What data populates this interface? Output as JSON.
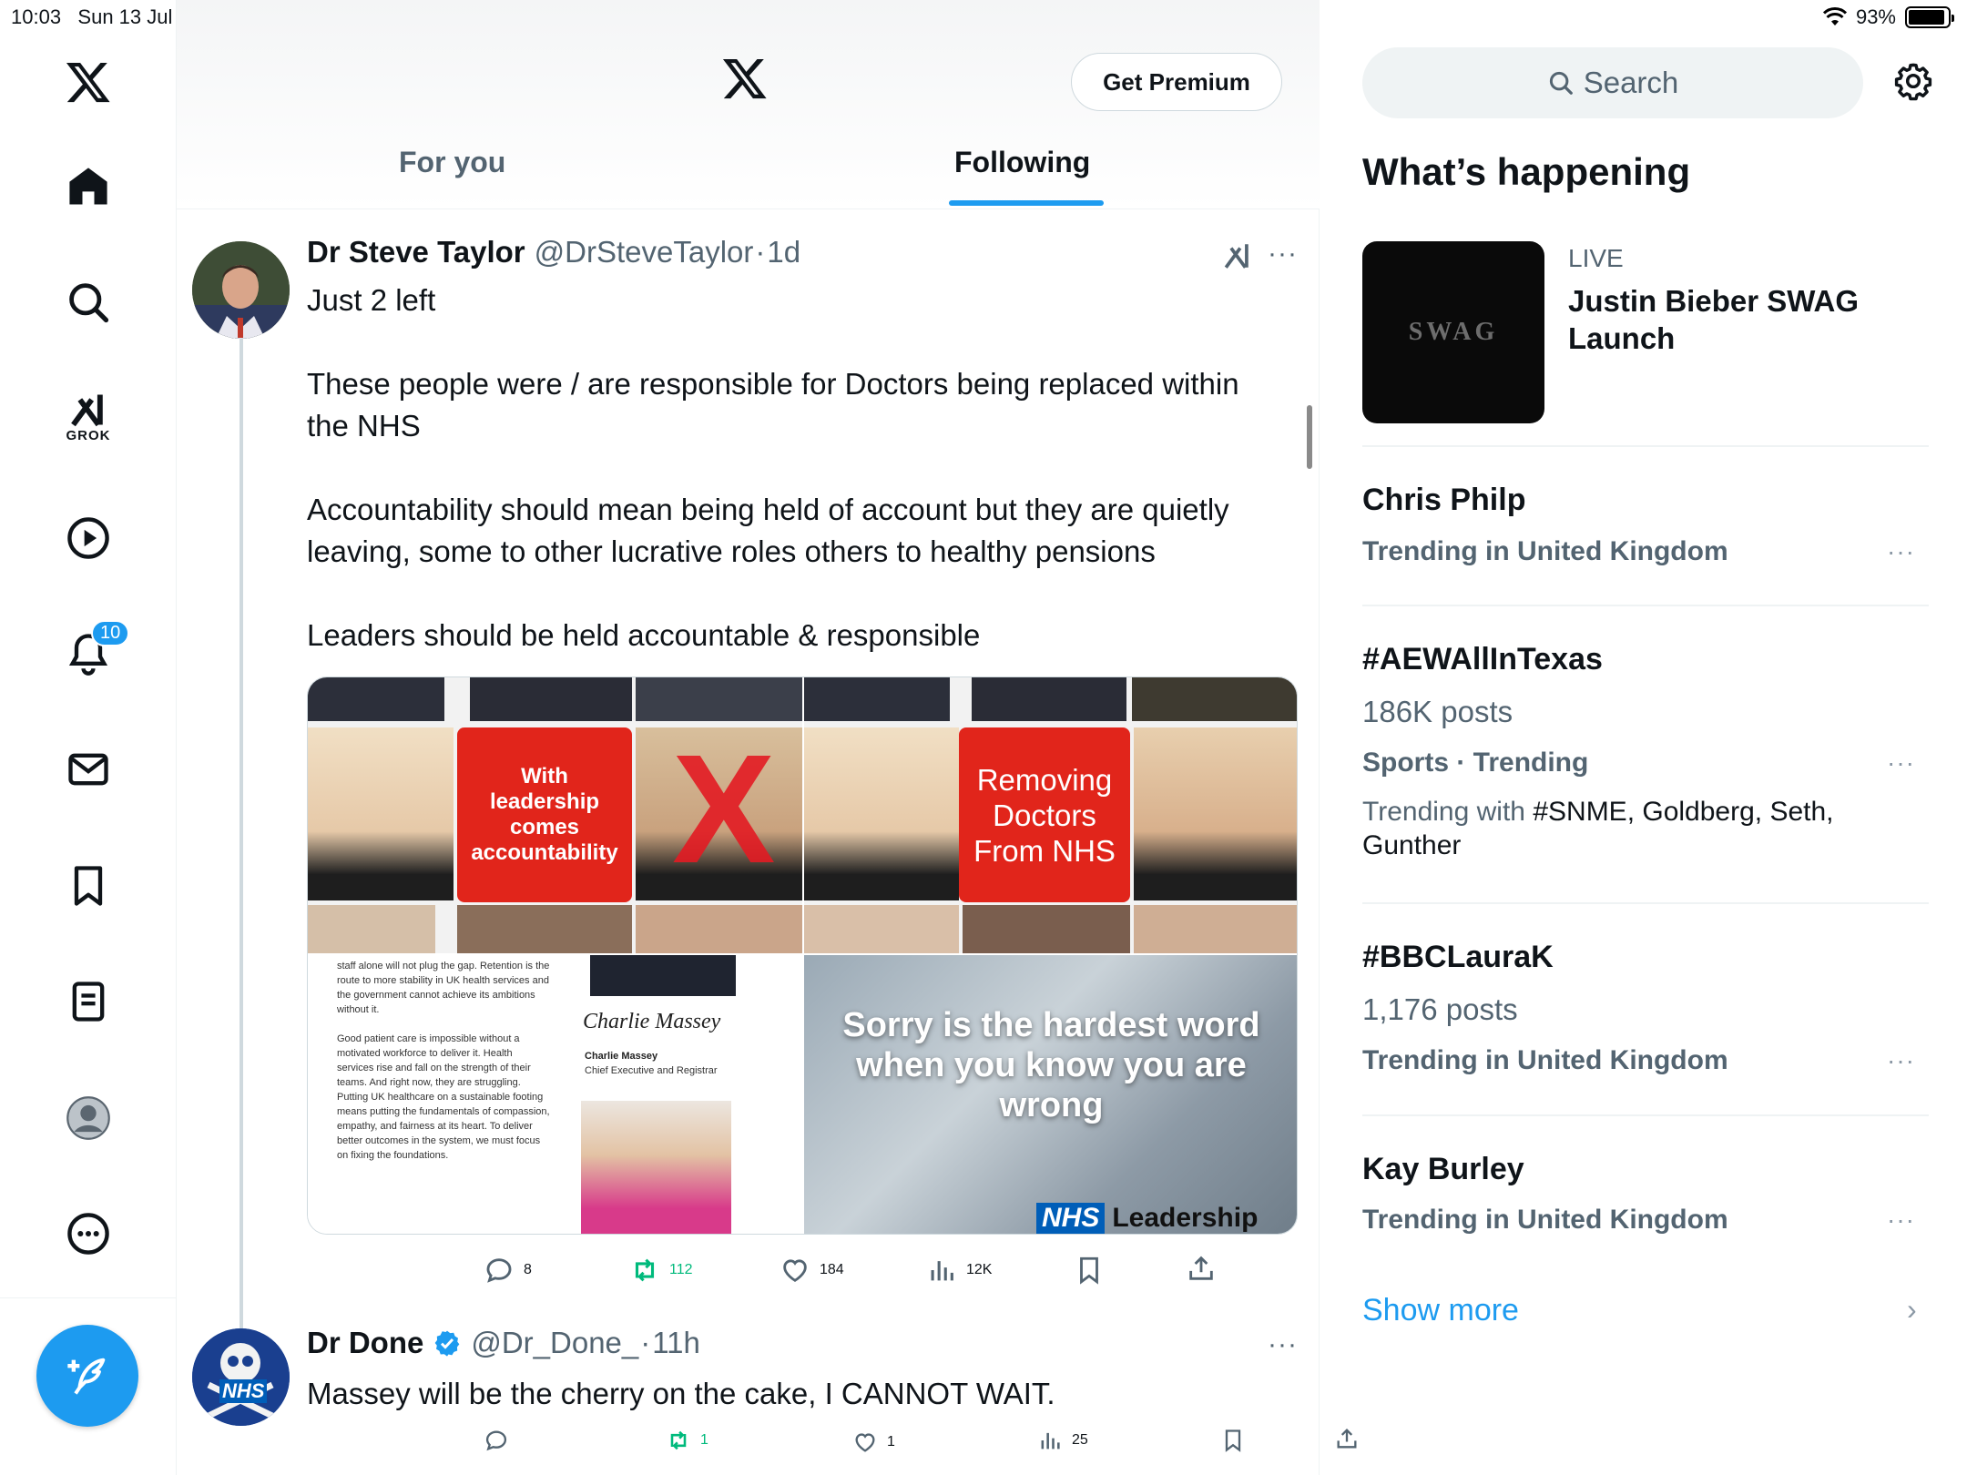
{
  "status_bar": {
    "time": "10:03",
    "date": "Sun 13 Jul",
    "dots": "•••",
    "battery": "93%",
    "battery_level": 0.93
  },
  "nav": {
    "grok_label": "GROK",
    "notifications_badge": "10",
    "icons": [
      "x-logo-icon",
      "home-icon",
      "search-icon",
      "grok-icon",
      "video-icon",
      "bell-icon",
      "mail-icon",
      "bookmark-icon",
      "list-icon",
      "profile-icon",
      "more-circle-icon",
      "compose-icon"
    ]
  },
  "header": {
    "premium_label": "Get Premium",
    "tabs": [
      {
        "label": "For you"
      },
      {
        "label": "Following"
      }
    ],
    "active_tab": "Following"
  },
  "tweets": [
    {
      "name": "Dr Steve Taylor",
      "handle": "@DrSteveTaylor",
      "dot": "·",
      "time": "1d",
      "more": "···",
      "paragraphs": [
        "Just 2 left",
        "These people were / are responsible for Doctors being replaced within the NHS",
        "Accountability should mean being held of account but they are quietly leaving, some to other lucrative roles others to healthy pensions",
        "Leaders should be held accountable & responsible"
      ],
      "media": {
        "panel1_text": "With leadership comes accountability",
        "panel2_text": "Removing Doctors From NHS",
        "panel3_doc_lines": [
          "staff alone will not plug the gap. Retention is the",
          "route to more stability in UK health services and",
          "the government cannot achieve its ambitions",
          "without it.",
          "",
          "Good patient care is impossible without a",
          "motivated workforce to deliver it. Health",
          "services rise and fall on the strength of their",
          "teams. And right now, they are struggling.",
          "Putting UK healthcare on a sustainable footing",
          "means putting the fundamentals of compassion,",
          "empathy, and fairness at its heart. To deliver",
          "better outcomes in the system, we must focus",
          "on fixing the foundations."
        ],
        "panel3_signature": "Charlie Massey",
        "panel3_sig_name": "Charlie Massey",
        "panel3_sig_role": "Chief Executive and Registrar",
        "panel4_text_line1": "Sorry is the hardest word",
        "panel4_text_line2": "when you know you are wrong",
        "panel4_logo": "NHS",
        "panel4_logo_text": "Leadership",
        "red_x": "X"
      },
      "actions": {
        "replies": "8",
        "retweets": "112",
        "likes": "184",
        "views": "12K"
      }
    },
    {
      "name": "Dr Done",
      "handle": "@Dr_Done_",
      "dot": "·",
      "time": "11h",
      "more": "···",
      "avatar_text": "NHS",
      "text": "Massey will be the cherry on the cake, I CANNOT WAIT.",
      "actions": {
        "replies": "",
        "retweets": "1",
        "likes": "1",
        "views": "25"
      }
    }
  ],
  "right": {
    "search_placeholder": "Search",
    "section_title": "What’s happening",
    "live": {
      "label": "LIVE",
      "title": "Justin Bieber SWAG Launch",
      "image_text": "SWAG"
    },
    "trends": [
      {
        "name": "Chris Philp",
        "sub": "Trending in United Kingdom",
        "more": "···"
      },
      {
        "name": "#AEWAllInTexas",
        "count": "186K posts",
        "sub": "Sports · Trending",
        "with_prefix": "Trending with",
        "with_items": "#SNME, Goldberg, Seth, Gunther",
        "more": "···"
      },
      {
        "name": "#BBCLauraK",
        "count": "1,176 posts",
        "sub": "Trending in United Kingdom",
        "more": "···"
      },
      {
        "name": "Kay Burley",
        "sub": "Trending in United Kingdom",
        "more": "···"
      }
    ],
    "show_more": "Show more",
    "chevron": "›"
  },
  "colors": {
    "accent": "#1d9bf0",
    "retweet": "#00ba7c",
    "secondary_text": "#536471",
    "nhs_red": "#e1251b",
    "nhs_blue": "#005eb8"
  }
}
